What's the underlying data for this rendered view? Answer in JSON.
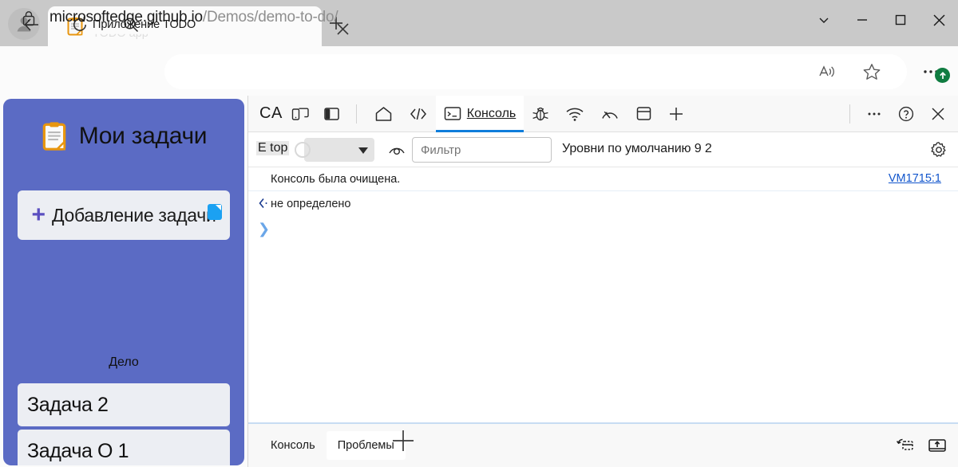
{
  "browser": {
    "titlebar": {
      "avatar_icon": "person-avatar-icon",
      "tab": {
        "favicon": "clipboard-icon",
        "title": "Приложение TODO",
        "ghost_title": "TODO app",
        "close_icon": "close-icon"
      },
      "new_tab_icon": "plus-icon",
      "window_controls": [
        {
          "name": "tab-actions-menu",
          "icon": "chevron-down-icon"
        },
        {
          "name": "minimize",
          "icon": "minimize-icon"
        },
        {
          "name": "maximize",
          "icon": "maximize-icon"
        },
        {
          "name": "close",
          "icon": "close-icon"
        }
      ]
    },
    "navbar": {
      "back_icon": "arrow-left-icon",
      "reload_icon": "refresh-icon",
      "search_icon": "search-icon",
      "address": {
        "lock_icon": "lock-icon",
        "host": "microsoftedge.github.io",
        "path": "/Demos/demo-to-do/"
      },
      "read_aloud_icon": "read-aloud-icon",
      "favorite_icon": "star-icon",
      "settings_icon": "ellipsis-icon",
      "update_badge_icon": "arrow-up-circle-icon",
      "update_badge_color": "#107c41"
    }
  },
  "page": {
    "app_background": "#5b6bc4",
    "header": {
      "icon": "clipboard-icon",
      "title": "Мои задачи"
    },
    "add_task_button": {
      "plus": "+",
      "label": "Добавление задачи"
    },
    "section_label": "Дело",
    "tasks": [
      {
        "label": "Задача 2"
      },
      {
        "label": "Задача О 1"
      }
    ]
  },
  "devtools": {
    "tabbar": {
      "inspect_label": "CA",
      "device_toggle_icon": "device-emulation-icon",
      "dock_panel_icon": "dock-side-icon",
      "tabs": [
        {
          "name": "welcome",
          "icon": "home-icon",
          "label": "",
          "active": false
        },
        {
          "name": "elements",
          "icon": "code-brackets-icon",
          "label": "",
          "active": false
        },
        {
          "name": "console",
          "icon": "console-terminal-icon",
          "label": "Консоль",
          "active": true
        },
        {
          "name": "sources",
          "icon": "bug-icon",
          "label": "",
          "active": false
        },
        {
          "name": "network",
          "icon": "wifi-icon",
          "label": "",
          "active": false
        },
        {
          "name": "performance",
          "icon": "gauge-icon",
          "label": "",
          "active": false
        },
        {
          "name": "application",
          "icon": "database-icon",
          "label": "",
          "active": false
        },
        {
          "name": "more-tools",
          "icon": "plus-icon",
          "label": "",
          "active": false
        }
      ],
      "more_icon": "ellipsis-icon",
      "help_icon": "question-circle-icon",
      "close_icon": "close-icon"
    },
    "filterbar": {
      "context_value": "E top",
      "context_arrow_icon": "triangle-down-icon",
      "eye_icon": "eye-icon",
      "filter_placeholder": "Фильтр",
      "filter_value": "",
      "levels_label": "Уровни по умолчанию 9 2",
      "settings_icon": "gear-icon"
    },
    "console": {
      "cleared_message": "Консоль была очищена.",
      "source_link": "VM1715:1",
      "source_link_color": "#1155cc",
      "return_arrow_icon": "return-arrow-icon",
      "result_value": "не определено",
      "prompt_chevron": "❯"
    },
    "drawer": {
      "tabs": [
        {
          "name": "console",
          "label": "Консоль",
          "selected": false
        },
        {
          "name": "issues",
          "label": "Проблемы",
          "selected": true
        }
      ],
      "cursor_icon": "plus-cursor-icon",
      "right_icons": [
        {
          "name": "restore-drawer-icon"
        },
        {
          "name": "open-in-panel-icon"
        }
      ]
    }
  }
}
